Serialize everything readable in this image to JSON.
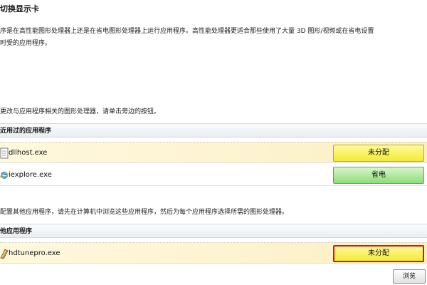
{
  "window": {
    "title": "切换显示卡",
    "description_line1": "序是在高性能图形处理器上还是在省电图形处理器上运行应用程序。高性能处理器更适合那些使用了大量 3D 图形/视频或在省电设置",
    "description_line2": "时受的应用程序。"
  },
  "recent": {
    "instruction": "更改与应用程序相关的图形处理器，请单击旁边的按钮。",
    "header": "近用过的应用程序",
    "apps": [
      {
        "name": "dllhost.exe",
        "gpu": "未分配",
        "icon": "dllhost-app-icon"
      },
      {
        "name": "iexplore.exe",
        "gpu": "省电",
        "icon": "internet-explorer-icon"
      }
    ]
  },
  "other": {
    "instruction": "配置其他应用程序，请先在计算机中浏览这些应用程序，然后为每个应用程序选择所需的图形处理器。",
    "header": "他应用程序",
    "apps": [
      {
        "name": "hdtunepro.exe",
        "gpu": "未分配",
        "icon": "hdtune-app-icon"
      }
    ],
    "browse_label": "浏览"
  },
  "colors": {
    "unassigned": "#f4ea36",
    "power_saving": "#8fdc7a",
    "focus_border": "#e0140e"
  }
}
